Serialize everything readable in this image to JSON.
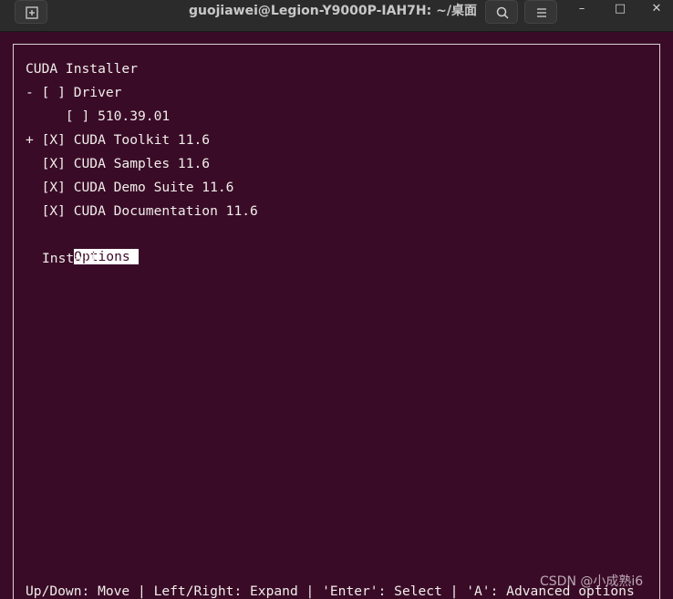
{
  "window": {
    "title": "guojiawei@Legion-Y9000P-IAH7H: ~/桌面",
    "new_tab_icon": "new-tab-icon",
    "search_icon": "search-icon",
    "menu_icon": "hamburger-menu-icon",
    "minimize": "–",
    "maximize": "□",
    "close": "✕"
  },
  "installer": {
    "title": "CUDA Installer",
    "items": [
      "- [ ] Driver",
      "     [ ] 510.39.01",
      "+ [X] CUDA Toolkit 11.6",
      "  [X] CUDA Samples 11.6",
      "  [X] CUDA Demo Suite 11.6",
      "  [X] CUDA Documentation 11.6"
    ],
    "options_label": "Options",
    "install_label": "Install",
    "footer": "Up/Down: Move | Left/Right: Expand | 'Enter': Select | 'A': Advanced options"
  },
  "watermark": "CSDN @小成熟i6",
  "colors": {
    "terminal_bg": "#3a0b27",
    "text": "#f0eeea",
    "highlight_bg": "#ffffff"
  }
}
